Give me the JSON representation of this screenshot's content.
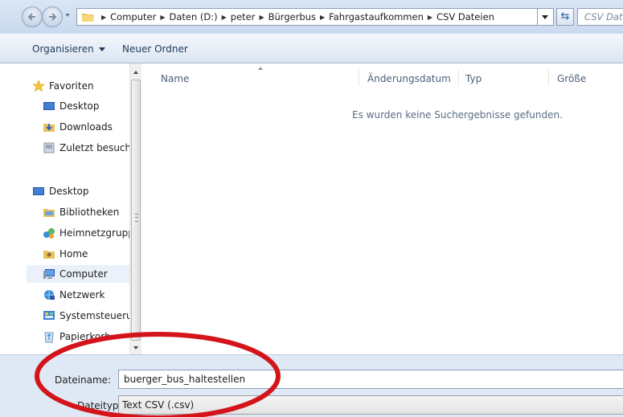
{
  "addressbar": {
    "breadcrumbs": [
      "Computer",
      "Daten (D:)",
      "peter",
      "Bürgerbus",
      "Fahrgastaufkommen",
      "CSV Dateien"
    ],
    "search_placeholder": "CSV Dateien durchsuchen"
  },
  "toolbar": {
    "organize_label": "Organisieren",
    "new_folder_label": "Neuer Ordner"
  },
  "navpane": {
    "items": [
      {
        "label": "Favoriten",
        "icon": "star-icon"
      },
      {
        "label": "Desktop",
        "icon": "desktop-icon"
      },
      {
        "label": "Downloads",
        "icon": "downloads-folder-icon"
      },
      {
        "label": "Zuletzt besucht",
        "icon": "recent-places-icon"
      },
      {
        "label": "Desktop",
        "icon": "desktop-icon"
      },
      {
        "label": "Bibliotheken",
        "icon": "libraries-icon"
      },
      {
        "label": "Heimnetzgruppe",
        "icon": "homegroup-icon"
      },
      {
        "label": "Home",
        "icon": "user-folder-icon"
      },
      {
        "label": "Computer",
        "icon": "computer-icon",
        "selected": true
      },
      {
        "label": "Netzwerk",
        "icon": "network-icon"
      },
      {
        "label": "Systemsteuerung",
        "icon": "control-panel-icon"
      },
      {
        "label": "Papierkorb",
        "icon": "recycle-bin-icon"
      }
    ]
  },
  "filelist": {
    "columns": [
      "Name",
      "Änderungsdatum",
      "Typ",
      "Größe"
    ],
    "empty_message": "Es wurden keine Suchergebnisse gefunden."
  },
  "form": {
    "filename_label": "Dateiname:",
    "filename_value": "buerger_bus_haltestellen",
    "filetype_label": "Dateityp:",
    "filetype_value": "Text CSV (.csv)"
  },
  "colors": {
    "annotation": "#d4141b",
    "selection": "#eaf1fa"
  }
}
